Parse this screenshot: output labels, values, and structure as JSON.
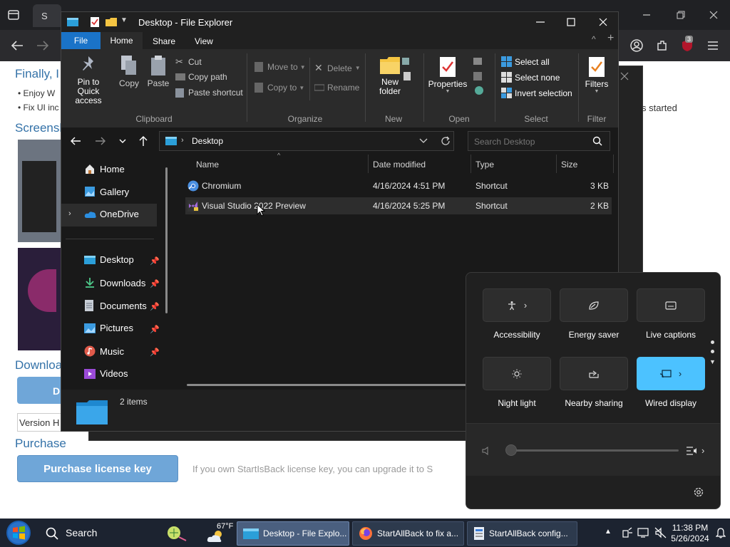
{
  "browser": {
    "tab_title": "S",
    "page": {
      "heading_finally": "Finally, I",
      "bullet1": "Enjoy W",
      "bullet2": "Fix UI inc",
      "side_text": "s started",
      "screenshots_heading": "Screensh",
      "downloads_heading": "Downloa",
      "download_btn": "D",
      "version_text": "Version H",
      "purchase_heading": "Purchase",
      "purchase_btn": "Purchase license key",
      "upgrade_text": "If you own StartIsBack license key, you can upgrade it to S"
    },
    "badge_count": "3"
  },
  "explorer": {
    "title": "Desktop - File Explorer",
    "tabs": [
      "File",
      "Home",
      "Share",
      "View"
    ],
    "ribbon": {
      "pin_quick_access": "Pin to Quick access",
      "copy": "Copy",
      "paste": "Paste",
      "cut": "Cut",
      "copy_path": "Copy path",
      "paste_shortcut": "Paste shortcut",
      "move_to": "Move to",
      "copy_to": "Copy to",
      "delete": "Delete",
      "rename": "Rename",
      "new_folder": "New folder",
      "properties": "Properties",
      "select_all": "Select all",
      "select_none": "Select none",
      "invert_selection": "Invert selection",
      "filters": "Filters",
      "groups": [
        "Clipboard",
        "Organize",
        "New",
        "Open",
        "Select",
        "Filter"
      ]
    },
    "address": "Desktop",
    "search_placeholder": "Search Desktop",
    "nav": {
      "home": "Home",
      "gallery": "Gallery",
      "onedrive": "OneDrive",
      "desktop": "Desktop",
      "downloads": "Downloads",
      "documents": "Documents",
      "pictures": "Pictures",
      "music": "Music",
      "videos": "Videos"
    },
    "columns": [
      "Name",
      "Date modified",
      "Type",
      "Size"
    ],
    "files": [
      {
        "name": "Chromium",
        "date": "4/16/2024 4:51 PM",
        "type": "Shortcut",
        "size": "3 KB"
      },
      {
        "name": "Visual Studio 2022 Preview",
        "date": "4/16/2024 5:25 PM",
        "type": "Shortcut",
        "size": "2 KB"
      }
    ],
    "status": "2 items"
  },
  "quick_settings": {
    "tiles": [
      {
        "label": "Accessibility",
        "on": false
      },
      {
        "label": "Energy saver",
        "on": false
      },
      {
        "label": "Live captions",
        "on": false
      },
      {
        "label": "Night light",
        "on": false
      },
      {
        "label": "Nearby sharing",
        "on": false
      },
      {
        "label": "Wired display",
        "on": true
      }
    ],
    "volume": 0
  },
  "taskbar": {
    "search": "Search",
    "weather": "67°F",
    "buttons": [
      "Desktop - File Explo...",
      "StartAllBack to fix a...",
      "StartAllBack config..."
    ],
    "time": "11:38 PM",
    "date": "5/26/2024"
  },
  "colors": {
    "accent": "#4cc2ff",
    "file_tab": "#1a73c8",
    "taskbar": "#1c2330"
  }
}
